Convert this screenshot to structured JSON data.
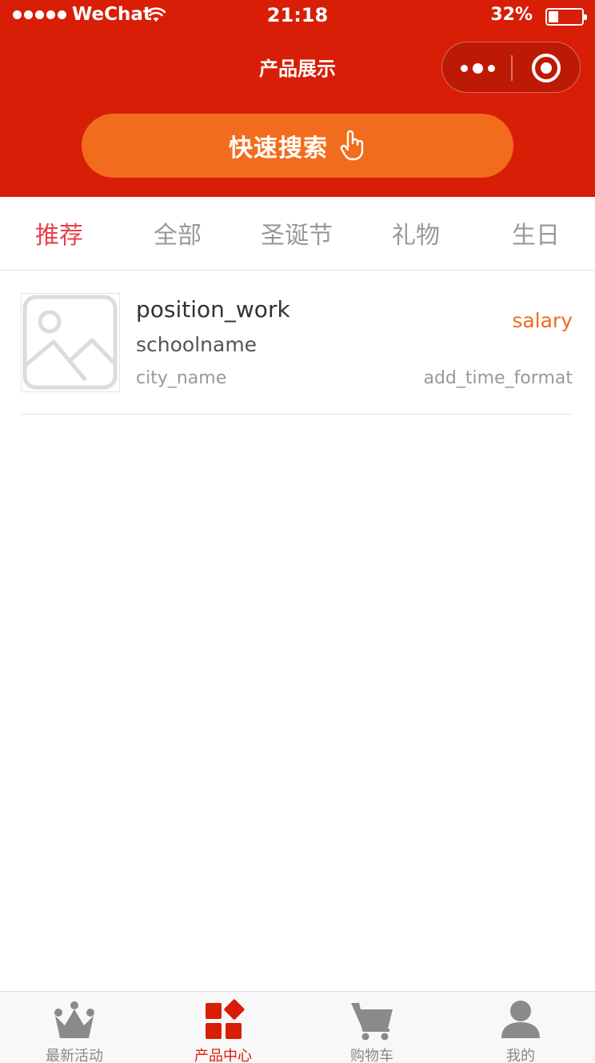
{
  "status_bar": {
    "carrier": "WeChat",
    "time": "21:18",
    "battery_percent": "32%",
    "battery_level": 0.32
  },
  "nav": {
    "title": "产品展示"
  },
  "search": {
    "label": "快速搜索"
  },
  "tabs": [
    {
      "label": "推荐",
      "active": true
    },
    {
      "label": "全部",
      "active": false
    },
    {
      "label": "圣诞节",
      "active": false
    },
    {
      "label": "礼物",
      "active": false
    },
    {
      "label": "生日",
      "active": false
    }
  ],
  "list": [
    {
      "title": "position_work",
      "school": "schoolname",
      "city": "city_name",
      "salary": "salary",
      "add_time": "add_time_format",
      "thumb_icon": "image-placeholder-icon"
    }
  ],
  "tabbar": [
    {
      "label": "最新活动",
      "icon": "crown-icon",
      "active": false
    },
    {
      "label": "产品中心",
      "icon": "grid-icon",
      "active": true
    },
    {
      "label": "购物车",
      "icon": "cart-icon",
      "active": false
    },
    {
      "label": "我的",
      "icon": "user-icon",
      "active": false
    }
  ],
  "colors": {
    "brand": "#d81e06",
    "accent": "#f26c1d",
    "tab_active": "#e8414b"
  }
}
